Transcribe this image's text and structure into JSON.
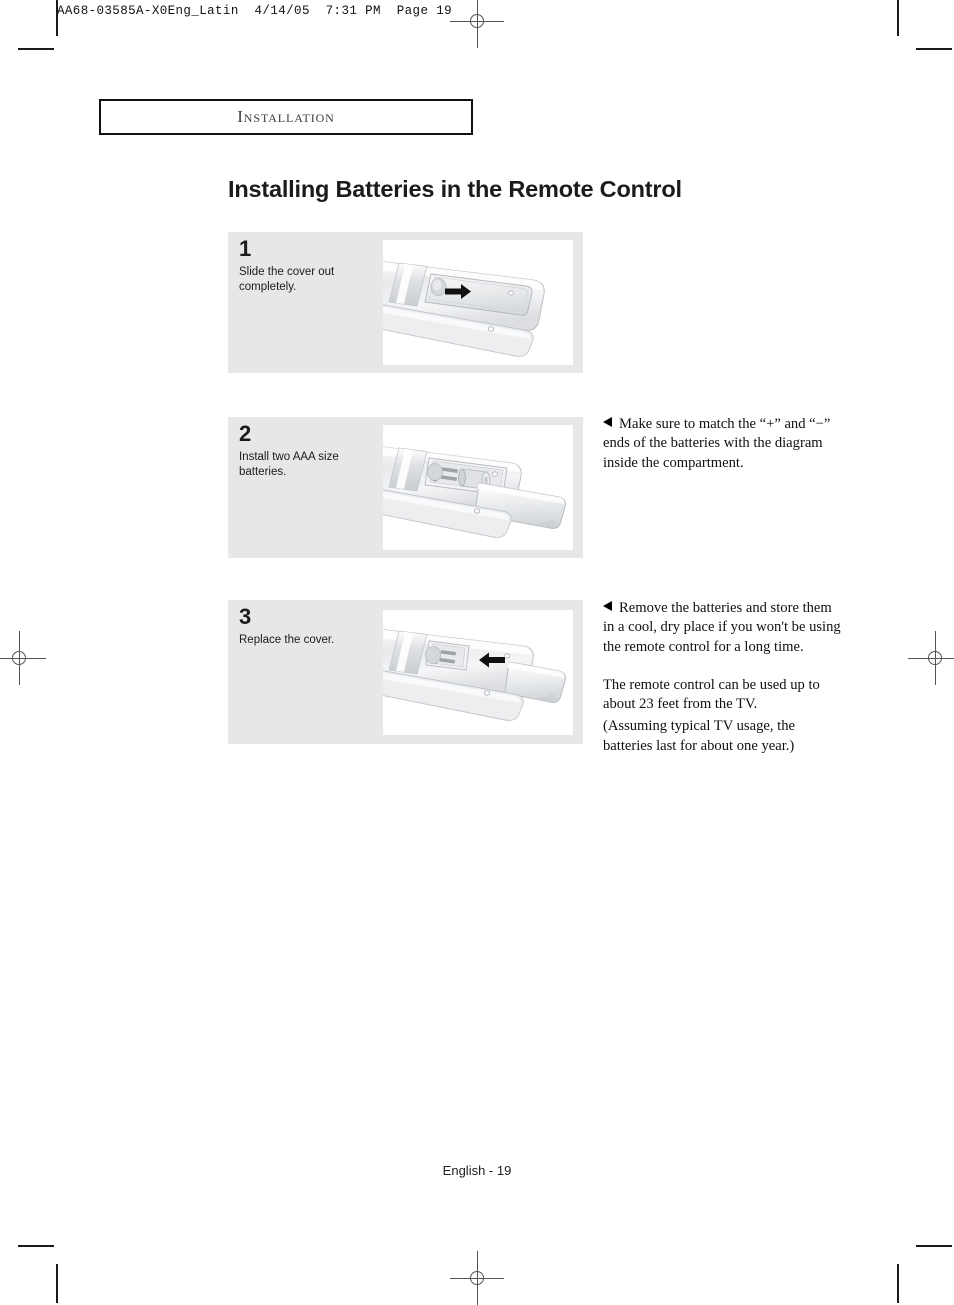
{
  "printer_marks": {
    "slug_line": "AA68-03585A-X0Eng_Latin  4/14/05  7:31 PM  Page 19",
    "registration_icon": "registration-crosshair-icon"
  },
  "chapter": {
    "label": "Installation"
  },
  "title": "Installing Batteries in the Remote Control",
  "steps": [
    {
      "number": "1",
      "text": "Slide the cover out completely.",
      "figure_name": "remote-back-cover-slide-figure",
      "arrow": "arrow-right-icon"
    },
    {
      "number": "2",
      "text": "Install two AAA size batteries.",
      "figure_name": "remote-battery-compartment-figure",
      "arrow": ""
    },
    {
      "number": "3",
      "text": "Replace the cover.",
      "figure_name": "remote-cover-replace-figure",
      "arrow": "arrow-left-icon"
    }
  ],
  "notes": [
    {
      "bullet": "triangle-left-bullet-icon",
      "paragraphs": [
        "Make sure to match the “+” and “−” ends of the batteries with the diagram inside the compartment."
      ]
    },
    {
      "bullet": "triangle-left-bullet-icon",
      "paragraphs": [
        "Remove the batteries and store them in a cool, dry place if you won't be using the remote control for a long time.",
        "The remote control can be used up to about 23 feet from the TV.",
        "(Assuming typical TV usage, the batteries last for about one year.)"
      ]
    }
  ],
  "footer": "English - 19",
  "colors": {
    "panel_gray": "#e7e7e7",
    "text_black": "#1b1b1b",
    "chapter_text": "#3b3b43"
  }
}
